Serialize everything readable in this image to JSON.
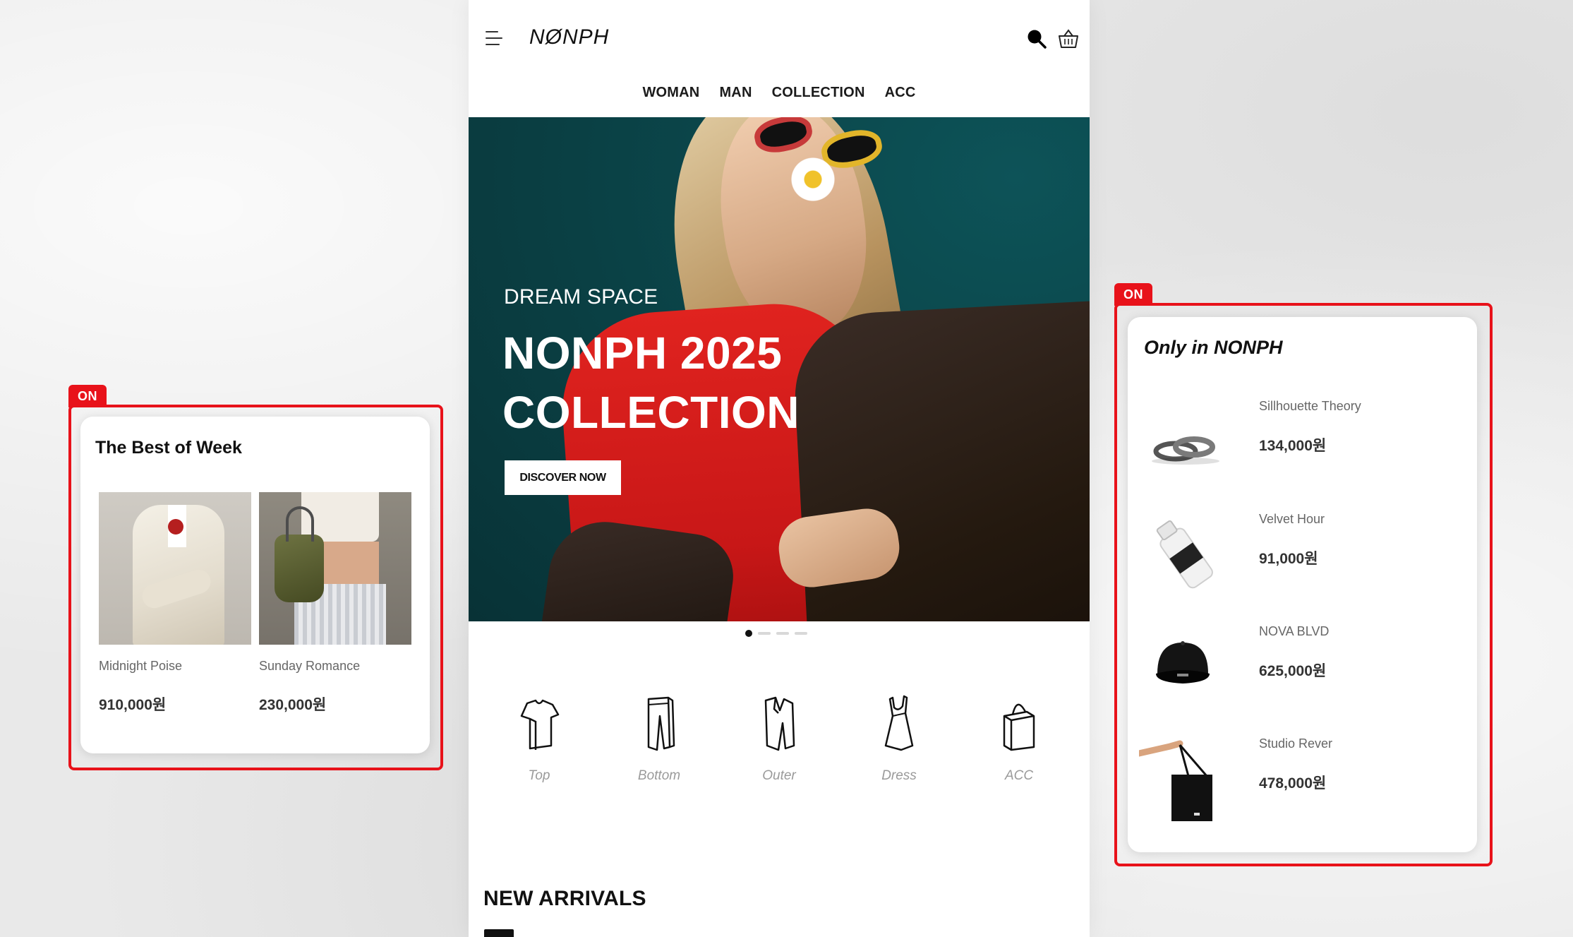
{
  "header": {
    "logo": "NØNPH",
    "menu_icon": "hamburger-menu-icon",
    "search_icon": "search-icon",
    "cart_icon": "shopping-basket-icon"
  },
  "nav": {
    "items": [
      "WOMAN",
      "MAN",
      "COLLECTION",
      "ACC"
    ]
  },
  "hero": {
    "subtitle": "DREAM SPACE",
    "title_line1": "NONPH 2025",
    "title_line2": "COLLECTION",
    "button_label": "DISCOVER NOW",
    "slide_count": 4,
    "active_slide": 1
  },
  "categories": [
    {
      "label": "Top",
      "icon": "t-shirt-icon"
    },
    {
      "label": "Bottom",
      "icon": "pants-icon"
    },
    {
      "label": "Outer",
      "icon": "jacket-icon"
    },
    {
      "label": "Dress",
      "icon": "dress-icon"
    },
    {
      "label": "ACC",
      "icon": "bag-icon"
    }
  ],
  "new_arrivals": {
    "title": "NEW ARRIVALS"
  },
  "best_of_week": {
    "badge": "ON",
    "title": "The Best of Week",
    "items": [
      {
        "name": "Midnight Poise",
        "price": "910,000원"
      },
      {
        "name": "Sunday Romance",
        "price": "230,000원"
      }
    ]
  },
  "only_in": {
    "badge": "ON",
    "title": "Only in NONPH",
    "items": [
      {
        "name": "Sillhouette Theory",
        "price": "134,000원",
        "icon": "rings-icon"
      },
      {
        "name": "Velvet Hour",
        "price": "91,000원",
        "icon": "perfume-bottle-icon"
      },
      {
        "name": "NOVA BLVD",
        "price": "625,000원",
        "icon": "cap-icon"
      },
      {
        "name": "Studio Rever",
        "price": "478,000원",
        "icon": "tote-bag-icon"
      }
    ]
  },
  "colors": {
    "accent_red": "#e8121a",
    "hero_teal": "#0a3f43",
    "text_dark": "#111111"
  }
}
